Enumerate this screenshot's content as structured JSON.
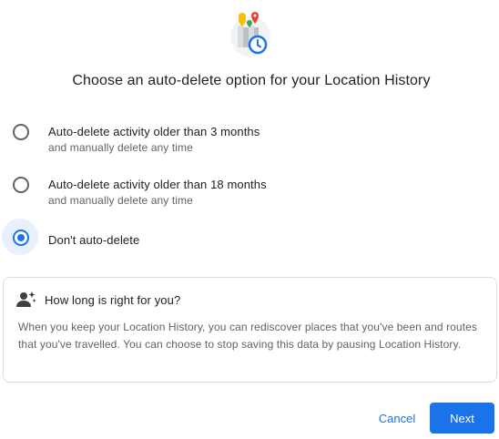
{
  "dialog": {
    "title": "Choose an auto-delete option for your Location History"
  },
  "options": [
    {
      "label": "Auto-delete activity older than 3 months",
      "sub": "and manually delete any time",
      "selected": false
    },
    {
      "label": "Auto-delete activity older than 18 months",
      "sub": "and manually delete any time",
      "selected": false
    },
    {
      "label": "Don't auto-delete",
      "sub": "",
      "selected": true
    }
  ],
  "info_card": {
    "title": "How long is right for you?",
    "body": "When you keep your Location History, you can rediscover places that you've been and routes that you've travelled. You can choose to stop saving this data by pausing Location History."
  },
  "actions": {
    "cancel_label": "Cancel",
    "next_label": "Next"
  },
  "colors": {
    "accent": "#1a73e8",
    "text_primary": "#202124",
    "text_secondary": "#5f6368",
    "border": "#dadce0"
  },
  "icons": {
    "hero": "location-history-clock-icon",
    "card": "person-sparkle-icon"
  }
}
